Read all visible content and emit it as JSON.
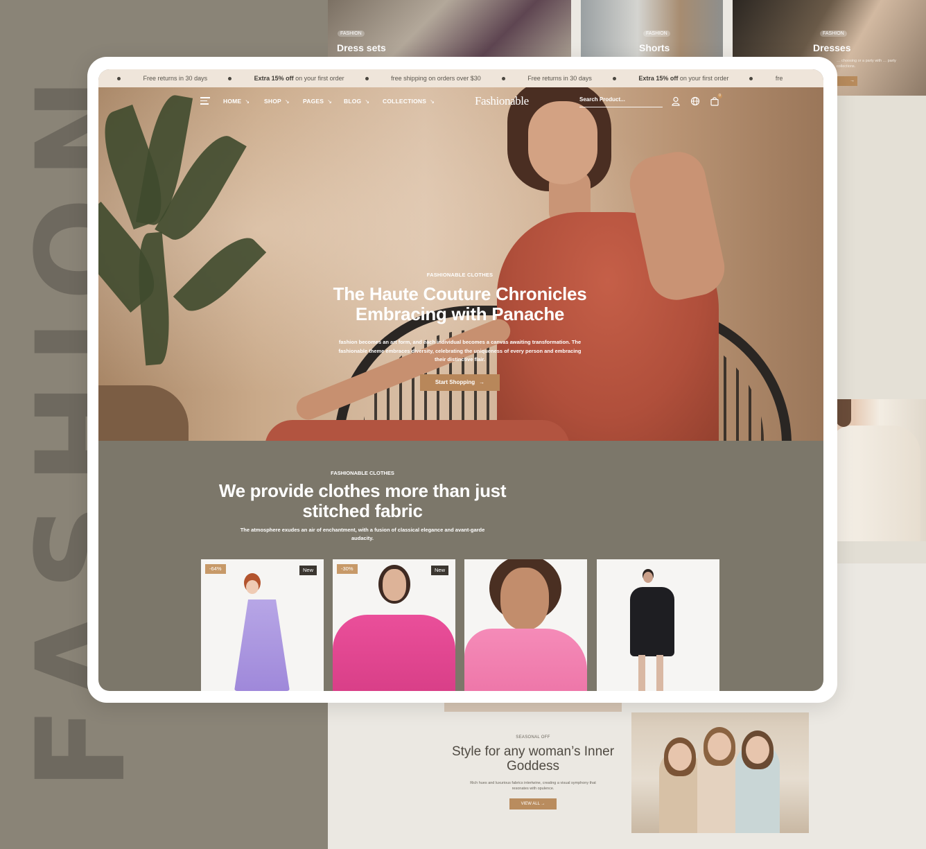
{
  "side_title": "FASHION 2",
  "categories": [
    {
      "badge": "FASHION",
      "name": "Dress sets"
    },
    {
      "badge": "FASHION",
      "name": "Shorts"
    },
    {
      "badge": "FASHION",
      "name": "Dresses",
      "copy": "… choosing or a party with … party collections."
    }
  ],
  "announcement": [
    {
      "text": "Free returns in 30 days"
    },
    {
      "bold": "Extra 15% off",
      "text": " on your first order"
    },
    {
      "text": "free shipping on orders over $30"
    },
    {
      "text": "Free returns in 30 days"
    },
    {
      "bold": "Extra 15% off",
      "text": " on your first order"
    },
    {
      "text": "fre"
    }
  ],
  "nav": {
    "links": [
      "HOME",
      "SHOP",
      "PAGES",
      "BLOG",
      "COLLECTIONS"
    ],
    "logo": "Fashionable",
    "search_placeholder": "Search Product...",
    "cart_count": "0",
    "icons": [
      "menu-icon",
      "user-icon",
      "globe-icon",
      "bag-icon"
    ]
  },
  "hero": {
    "eyebrow": "FASHIONABLE CLOTHES",
    "title": "The Haute Couture Chronicles Embracing with Panache",
    "copy": "fashion becomes an art form, and each individual becomes a canvas awaiting transformation. The fashionable theme embraces diversity, celebrating the uniqueness of every person and embracing their distinctive flair.",
    "cta": "Start Shopping"
  },
  "products_section": {
    "eyebrow": "FASHIONABLE CLOTHES",
    "title": "We provide clothes more than just stitched fabric",
    "copy": "The atmosphere exudes an air of enchantment, with a fusion of classical elegance and avant-garde audacity."
  },
  "products": [
    {
      "discount": "-64%",
      "badge": "New"
    },
    {
      "discount": "-30%",
      "badge": "New"
    },
    {
      "discount": "",
      "badge": ""
    },
    {
      "discount": "",
      "badge": ""
    }
  ],
  "seasonal": {
    "eyebrow": "SEASONAL OFF",
    "title": "Style for any woman’s Inner Goddess",
    "copy": "Rich hues and luxurious fabrics intertwine, creating a visual symphony that resonates with opulence.",
    "cta": "VIEW ALL"
  },
  "colors": {
    "accent": "#b8875a",
    "section_bg": "#7c776a",
    "announce_bg": "#efe5da"
  }
}
